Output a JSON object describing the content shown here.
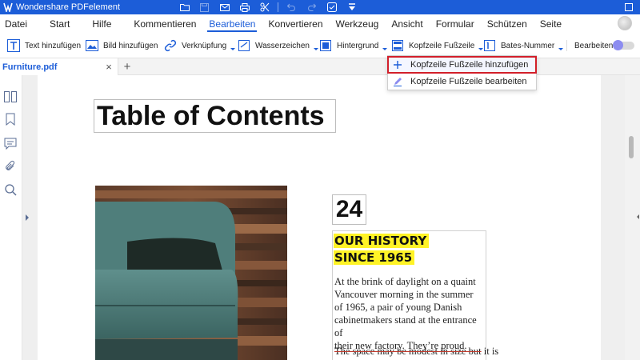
{
  "titlebar": {
    "app_title": "Wondershare PDFelement",
    "quick_icons": [
      "folder-icon",
      "save-icon",
      "mail-icon",
      "print-icon",
      "share-icon",
      "undo-icon",
      "redo-icon",
      "check-icon",
      "more-icon"
    ]
  },
  "menu": {
    "items": [
      "Datei",
      "Start",
      "Hilfe",
      "Kommentieren",
      "Bearbeiten",
      "Konvertieren",
      "Werkzeug",
      "Ansicht",
      "Formular",
      "Schützen",
      "Seite"
    ],
    "active": "Bearbeiten"
  },
  "toolbar": {
    "text_add": "Text hinzufügen",
    "image_add": "Bild hinzufügen",
    "link": "Verknüpfung",
    "watermark": "Wasserzeichen",
    "background": "Hintergrund",
    "header_footer": "Kopfzeile  Fußzeile",
    "bates": "Bates-Nummer",
    "edit": "Bearbeiten"
  },
  "tab": {
    "filename": "Furniture.pdf",
    "close_symbol": "×",
    "new_symbol": "+"
  },
  "dropdown": {
    "add_label": "Kopfzeile  Fußzeile hinzufügen",
    "edit_label": "Kopfzeile  Fußzeile bearbeiten"
  },
  "document": {
    "title": "Table of Contents",
    "page_number": "24",
    "history_line1": "OUR HISTORY",
    "history_line2": "SINCE 1965",
    "paragraph_lines": [
      "At the brink of daylight on a quaint",
      "Vancouver morning in the summer",
      "of 1965, a pair of young Danish",
      "cabinetmakers stand at the entrance of",
      "their new factory. They’re proud."
    ],
    "strike_text": "The space may be modest in size but",
    "after_strike": " it is"
  },
  "colors": {
    "accent": "#1c5dd8",
    "highlight": "#fff326",
    "dropdown_outline": "#d21f2a"
  }
}
